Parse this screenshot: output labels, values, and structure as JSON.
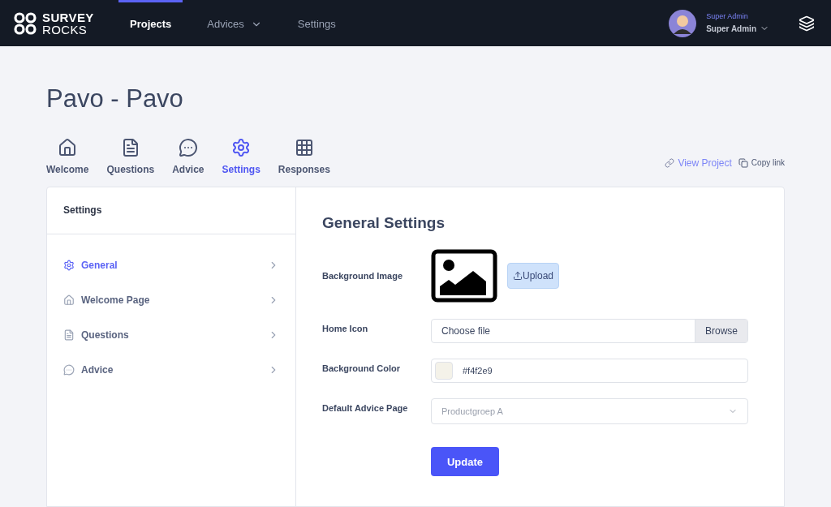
{
  "brand": {
    "line1": "SURVEY",
    "line2": "ROCKS"
  },
  "nav": [
    {
      "label": "Projects",
      "selected": true,
      "dropdown": false
    },
    {
      "label": "Advices",
      "selected": false,
      "dropdown": true
    },
    {
      "label": "Settings",
      "selected": false,
      "dropdown": false
    }
  ],
  "user": {
    "role": "Super Admin",
    "name": "Super Admin"
  },
  "page_title": "Pavo - Pavo",
  "tabs": [
    {
      "label": "Welcome",
      "kind": "home",
      "selected": false
    },
    {
      "label": "Questions",
      "kind": "questions",
      "selected": false
    },
    {
      "label": "Advice",
      "kind": "advice",
      "selected": false
    },
    {
      "label": "Settings",
      "kind": "settings",
      "selected": true
    },
    {
      "label": "Responses",
      "kind": "responses",
      "selected": false
    }
  ],
  "links": {
    "view": "View Project",
    "copy": "Copy link"
  },
  "sidebar": {
    "title": "Settings",
    "items": [
      {
        "label": "General",
        "kind": "settings",
        "selected": true
      },
      {
        "label": "Welcome Page",
        "kind": "home",
        "selected": false
      },
      {
        "label": "Questions",
        "kind": "questions",
        "selected": false
      },
      {
        "label": "Advice",
        "kind": "advice",
        "selected": false
      }
    ]
  },
  "form": {
    "title": "General Settings",
    "fields": [
      {
        "kind": "image",
        "label": "Background Image",
        "button": "Upload"
      },
      {
        "kind": "file",
        "label": "Home Icon",
        "placeholder": "Choose file",
        "button": "Browse"
      },
      {
        "kind": "color",
        "label": "Background Color",
        "value": "#f4f2e9"
      },
      {
        "kind": "select",
        "label": "Default Advice Page",
        "value": "Productgroep A"
      }
    ],
    "submit": "Update"
  }
}
